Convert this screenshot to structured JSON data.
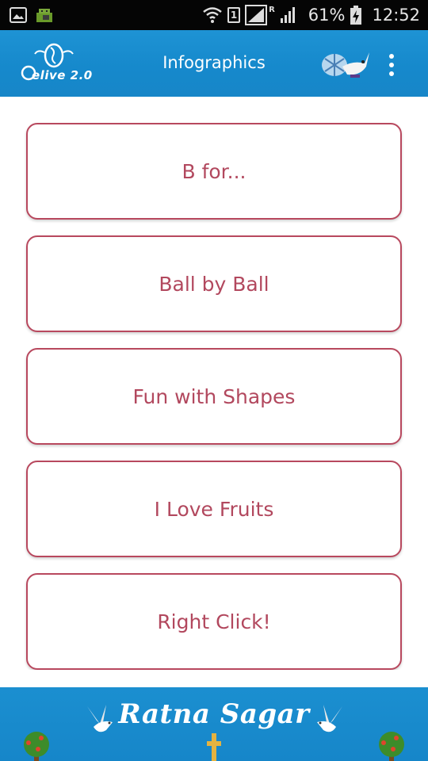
{
  "status_bar": {
    "battery_percent": "61%",
    "time": "12:52",
    "sim_slot": "1",
    "roaming": "R"
  },
  "app_bar": {
    "logo_text": "elive 2.0",
    "title": "Infographics"
  },
  "list": {
    "items": [
      {
        "label": "B for..."
      },
      {
        "label": "Ball by Ball"
      },
      {
        "label": "Fun with Shapes"
      },
      {
        "label": "I Love Fruits"
      },
      {
        "label": "Right Click!"
      }
    ]
  },
  "footer": {
    "brand": "Ratna Sagar"
  },
  "colors": {
    "app_bar_blue": "#1689cc",
    "card_border": "#b8485e",
    "card_text": "#b2485e",
    "status_bar_bg": "#050505"
  },
  "icons": [
    "image-icon",
    "android-icon",
    "wifi-icon",
    "signal-icon",
    "battery-charging-icon",
    "overflow-menu-icon",
    "seahorse-logo-icon",
    "bird-icon",
    "tree-icon"
  ]
}
